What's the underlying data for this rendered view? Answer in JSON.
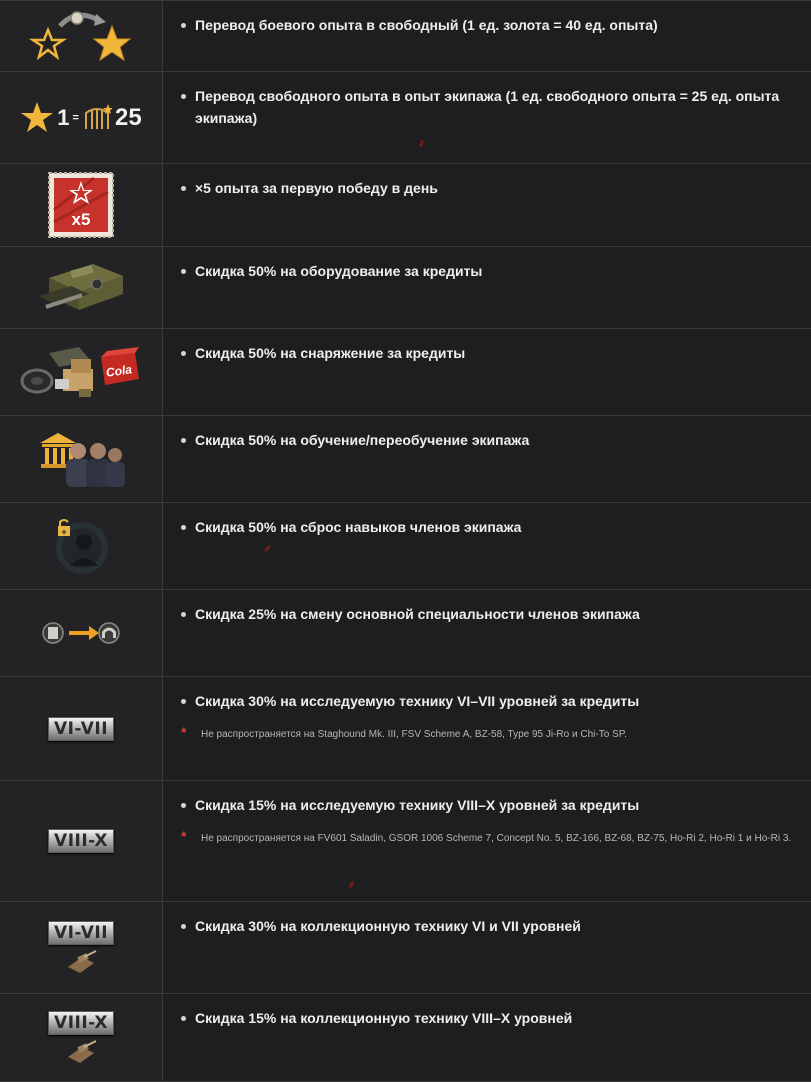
{
  "rows": [
    {
      "icon": "gold-to-free-xp-icon",
      "text": "Перевод боевого опыта в свободный (1 ед. золота = 40 ед. опыта)"
    },
    {
      "icon": "free-xp-to-crew-xp-icon",
      "icon_text": {
        "one": "1",
        "eq": "=",
        "amount": "25"
      },
      "text": "Перевод свободного опыта в опыт экипажа (1 ед. свободного опыта = 25 ед. опыта экипажа)"
    },
    {
      "icon": "x5-stamp-icon",
      "stamp_label": "x5",
      "text": "×5 опыта за первую победу в день"
    },
    {
      "icon": "equipment-crates-icon",
      "text": "Скидка 50% на оборудование за кредиты"
    },
    {
      "icon": "consumables-pile-icon",
      "crate_label": "Cola",
      "text": "Скидка 50% на снаряжение за кредиты"
    },
    {
      "icon": "crew-academy-icon",
      "text": "Скидка 50% на обучение/переобучение экипажа"
    },
    {
      "icon": "skill-reset-icon",
      "text": "Скидка 50% на сброс навыков членов экипажа"
    },
    {
      "icon": "specialty-change-icon",
      "text": "Скидка 25% на смену основной специальности членов экипажа"
    },
    {
      "icon": "tier-badge-icon",
      "tier": "VI-VII",
      "text": "Скидка 30% на исследуемую технику VI–VII уровней за кредиты",
      "note_mark": "*",
      "note": "Не распространяется на Staghound Mk. III, FSV Scheme A, BZ-58, Type 95 Ji-Ro и Chi-To SP."
    },
    {
      "icon": "tier-badge-icon",
      "tier": "VIII-X",
      "text": "Скидка 15% на исследуемую технику VIII–X уровней за кредиты",
      "note_mark": "*",
      "note": "Не распространяется на FV601 Saladin, GSOR 1006 Scheme 7, Concept No. 5, BZ-166, BZ-68, BZ-75, Ho-Ri 2, Ho-Ri 1 и Ho-Ri 3."
    },
    {
      "icon": "collectible-tier-icon",
      "tier": "VI-VII",
      "text": "Скидка 30% на коллекционную технику VI и VII уровней"
    },
    {
      "icon": "collectible-tier-icon",
      "tier": "VIII-X",
      "text": "Скидка 15% на коллекционную технику VIII–X уровней"
    }
  ],
  "colors": {
    "background": "#1c1c1e",
    "border": "#3a3a3c",
    "gold": "#f2b63a",
    "note_asterisk": "#d2452f",
    "stamp_red": "#c8322c"
  }
}
